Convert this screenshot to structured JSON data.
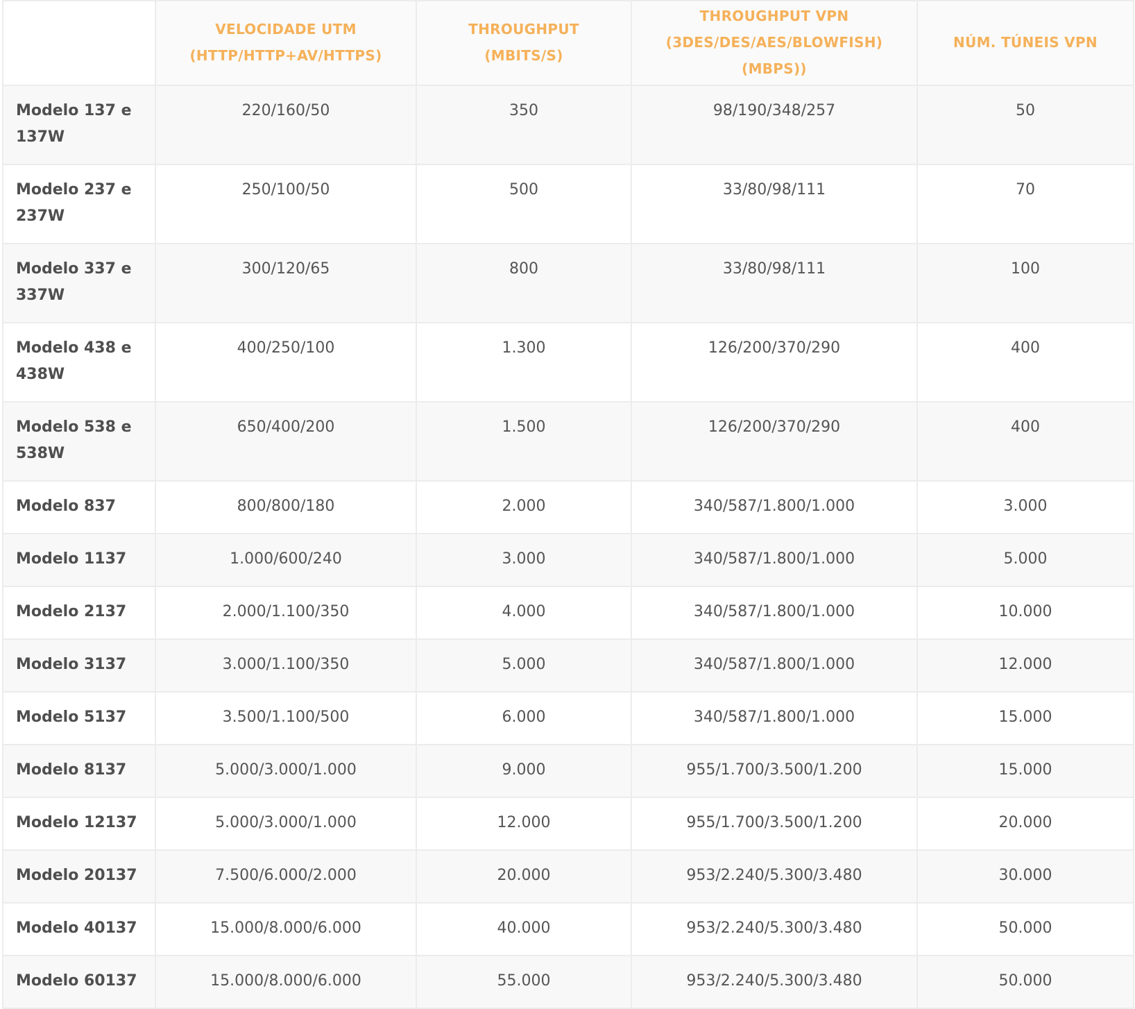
{
  "table": {
    "headers": [
      "",
      "VELOCIDADE UTM (HTTP/HTTP+AV/HTTPS)",
      "THROUGHPUT (MBITS/S)",
      "THROUGHPUT VPN (3DES/DES/AES/BLOWFISH)(MBPS))",
      "NÚM. TÚNEIS VPN"
    ],
    "rows": [
      [
        "Modelo 137 e 137W",
        "220/160/50",
        "350",
        "98/190/348/257",
        "50"
      ],
      [
        "Modelo 237 e 237W",
        "250/100/50",
        "500",
        "33/80/98/111",
        "70"
      ],
      [
        "Modelo 337 e 337W",
        "300/120/65",
        "800",
        "33/80/98/111",
        "100"
      ],
      [
        "Modelo 438 e 438W",
        "400/250/100",
        "1.300",
        "126/200/370/290",
        "400"
      ],
      [
        "Modelo 538 e 538W",
        "650/400/200",
        "1.500",
        "126/200/370/290",
        "400"
      ],
      [
        "Modelo 837",
        "800/800/180",
        "2.000",
        "340/587/1.800/1.000",
        "3.000"
      ],
      [
        "Modelo 1137",
        "1.000/600/240",
        "3.000",
        "340/587/1.800/1.000",
        "5.000"
      ],
      [
        "Modelo 2137",
        "2.000/1.100/350",
        "4.000",
        "340/587/1.800/1.000",
        "10.000"
      ],
      [
        "Modelo 3137",
        "3.000/1.100/350",
        "5.000",
        "340/587/1.800/1.000",
        "12.000"
      ],
      [
        "Modelo 5137",
        "3.500/1.100/500",
        "6.000",
        "340/587/1.800/1.000",
        "15.000"
      ],
      [
        "Modelo 8137",
        "5.000/3.000/1.000",
        "9.000",
        "955/1.700/3.500/1.200",
        "15.000"
      ],
      [
        "Modelo 12137",
        "5.000/3.000/1.000",
        "12.000",
        "955/1.700/3.500/1.200",
        "20.000"
      ],
      [
        "Modelo 20137",
        "7.500/6.000/2.000",
        "20.000",
        "953/2.240/5.300/3.480",
        "30.000"
      ],
      [
        "Modelo 40137",
        "15.000/8.000/6.000",
        "40.000",
        "953/2.240/5.300/3.480",
        "50.000"
      ],
      [
        "Modelo 60137",
        "15.000/8.000/6.000",
        "55.000",
        "953/2.240/5.300/3.480",
        "50.000"
      ]
    ]
  },
  "colors": {
    "header_text": "#f5b15a",
    "body_text": "#555555",
    "border": "#ececec",
    "row_alt": "#f8f8f8"
  }
}
